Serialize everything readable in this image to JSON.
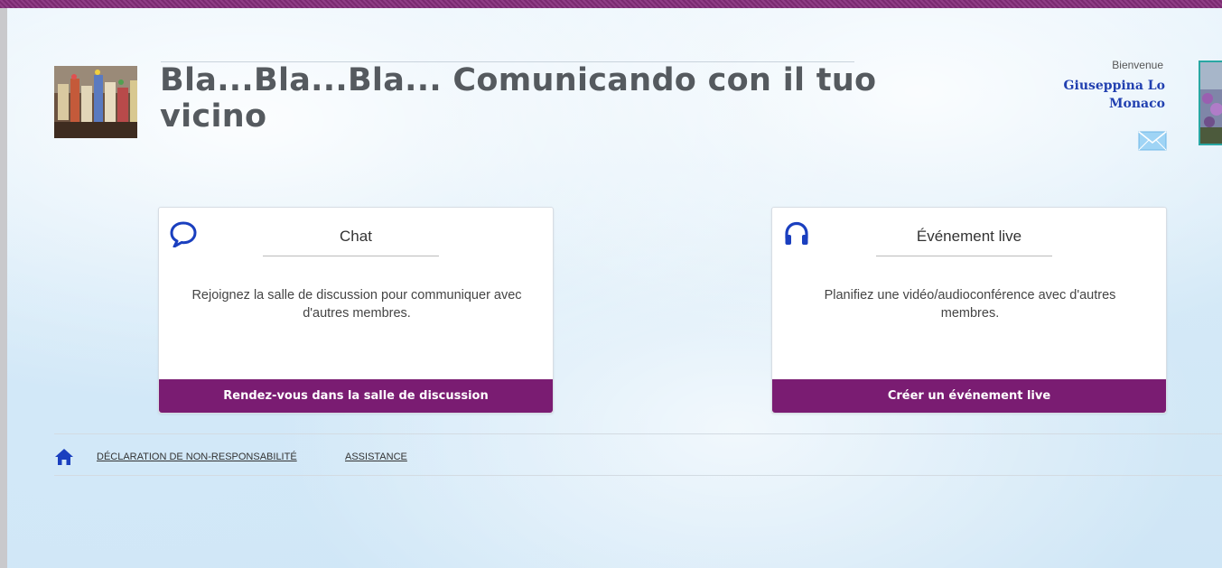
{
  "header": {
    "site_title": "Bla...Bla...Bla... Comunicando con il tuo vicino",
    "welcome_label": "Bienvenue",
    "user_name": "Giuseppina Lo Monaco"
  },
  "cards": [
    {
      "title": "Chat",
      "description": "Rejoignez la salle de discussion pour communiquer avec d'autres membres.",
      "action_label": "Rendez-vous dans la salle de discussion",
      "icon": "chat-bubble-icon"
    },
    {
      "title": "Événement live",
      "description": "Planifiez une vidéo/audioconférence avec d'autres membres.",
      "action_label": "Créer un événement live",
      "icon": "headphones-icon"
    }
  ],
  "footer": {
    "links": [
      "DÉCLARATION DE NON-RESPONSABILITÉ",
      "ASSISTANCE"
    ],
    "home_icon": "home-icon"
  },
  "colors": {
    "accent": "#7a1c72",
    "icon_blue": "#1a3fbf",
    "user_name": "#2140b0"
  }
}
